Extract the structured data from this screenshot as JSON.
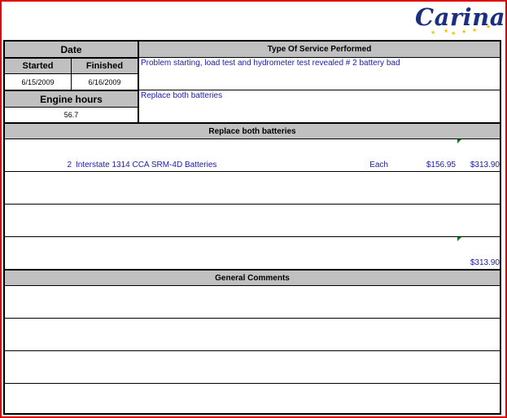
{
  "logo": {
    "text": "Carina"
  },
  "date_section": {
    "header": "Date",
    "started_label": "Started",
    "finished_label": "Finished",
    "started_value": "6/15/2009",
    "finished_value": "6/16/2009"
  },
  "engine_section": {
    "header": "Engine hours",
    "value": "56.7"
  },
  "service": {
    "header": "Type Of Service Performed",
    "description": "Problem starting, load test and hydrometer test revealed # 2 battery bad",
    "action": "Replace both batteries"
  },
  "parts": {
    "header": "Replace both batteries",
    "line_item": {
      "qty": "2",
      "description": "Interstate 1314 CCA SRM-4D Batteries",
      "unit": "Each",
      "unit_price": "$156.95",
      "total": "$313.90"
    },
    "grand_total": "$313.90"
  },
  "comments": {
    "header": "General Comments"
  },
  "colors": {
    "frame": "#e00000",
    "header_bg": "#c0c0c0",
    "text_blue": "#1a1ab0",
    "logo_blue": "#1a2f80",
    "logo_star": "#f2c200"
  }
}
